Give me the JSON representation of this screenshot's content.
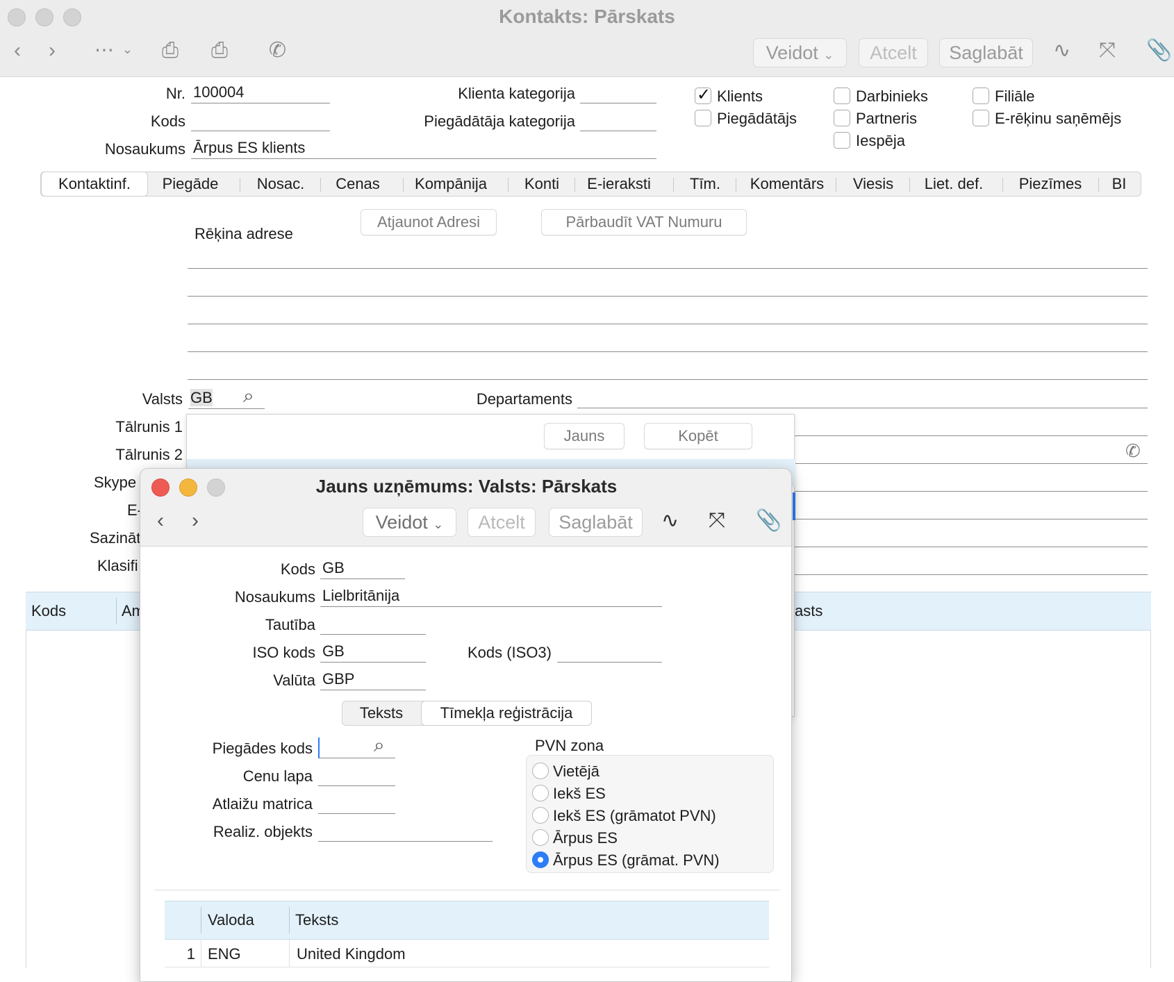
{
  "window": {
    "title": "Kontakts: Pārskats",
    "toolbar": {
      "create": "Veidot",
      "cancel": "Atcelt",
      "save": "Saglabāt"
    }
  },
  "header": {
    "nr_label": "Nr.",
    "nr_value": "100004",
    "code_label": "Kods",
    "code_value": "",
    "name_label": "Nosaukums",
    "name_value": "Ārpus ES klients",
    "client_cat_label": "Klienta kategorija",
    "supplier_cat_label": "Piegādātāja kategorija"
  },
  "checkboxes": [
    {
      "label": "Klients",
      "checked": true
    },
    {
      "label": "Piegādātājs",
      "checked": false
    },
    {
      "label": "Darbinieks",
      "checked": false
    },
    {
      "label": "Partneris",
      "checked": false
    },
    {
      "label": "Iespēja",
      "checked": false
    },
    {
      "label": "Filiāle",
      "checked": false
    },
    {
      "label": "E-rēķinu saņēmējs",
      "checked": false
    }
  ],
  "tabs": [
    "Kontaktinf.",
    "Piegāde",
    "Nosac.",
    "Cenas",
    "Kompānija",
    "Konti",
    "E-ieraksti",
    "Tīm.",
    "Komentārs",
    "Viesis",
    "Liet. def.",
    "Piezīmes",
    "BI"
  ],
  "address": {
    "label": "Rēķina adrese",
    "update_button": "Atjaunot Adresi",
    "check_vat_button": "Pārbaudīt VAT Numuru"
  },
  "contact": {
    "country_label": "Valsts",
    "country_value": "GB",
    "department_label": "Departaments",
    "phone1_label": "Tālrunis 1",
    "phone2_label": "Tālrunis 2",
    "skype_label": "Skype",
    "email_label": "E-",
    "contact_label": "Sazināt",
    "class_label": "Klasifi"
  },
  "popup": {
    "new_button": "Jauns",
    "copy_button": "Kopēt"
  },
  "table": {
    "col_code": "Kods",
    "col_am": "Am",
    "col_last": "asts"
  },
  "dialog": {
    "title": "Jauns uzņēmums: Valsts: Pārskats",
    "toolbar": {
      "create": "Veidot",
      "cancel": "Atcelt",
      "save": "Saglabāt"
    },
    "code_label": "Kods",
    "code_value": "GB",
    "name_label": "Nosaukums",
    "name_value": "Lielbritānija",
    "nationality_label": "Tautība",
    "nationality_value": "",
    "iso_label": "ISO kods",
    "iso_value": "GB",
    "iso3_label": "Kods (ISO3)",
    "iso3_value": "",
    "currency_label": "Valūta",
    "currency_value": "GBP",
    "subtabs": [
      "Teksts",
      "Tīmekļa reģistrācija"
    ],
    "delivery_code_label": "Piegādes kods",
    "price_list_label": "Cenu lapa",
    "discount_matrix_label": "Atlaižu matrica",
    "sales_object_label": "Realiz. objekts",
    "vat_zone": {
      "label": "PVN zona",
      "options": [
        "Vietējā",
        "Iekš ES",
        "Iekš ES (grāmatot PVN)",
        "Ārpus ES",
        "Ārpus ES (grāmat. PVN)"
      ],
      "selected": "Ārpus ES (grāmat. PVN)"
    },
    "text_table": {
      "col_language": "Valoda",
      "col_text": "Teksts",
      "rows": [
        {
          "n": "1",
          "language": "ENG",
          "text": "United Kingdom"
        }
      ]
    }
  }
}
